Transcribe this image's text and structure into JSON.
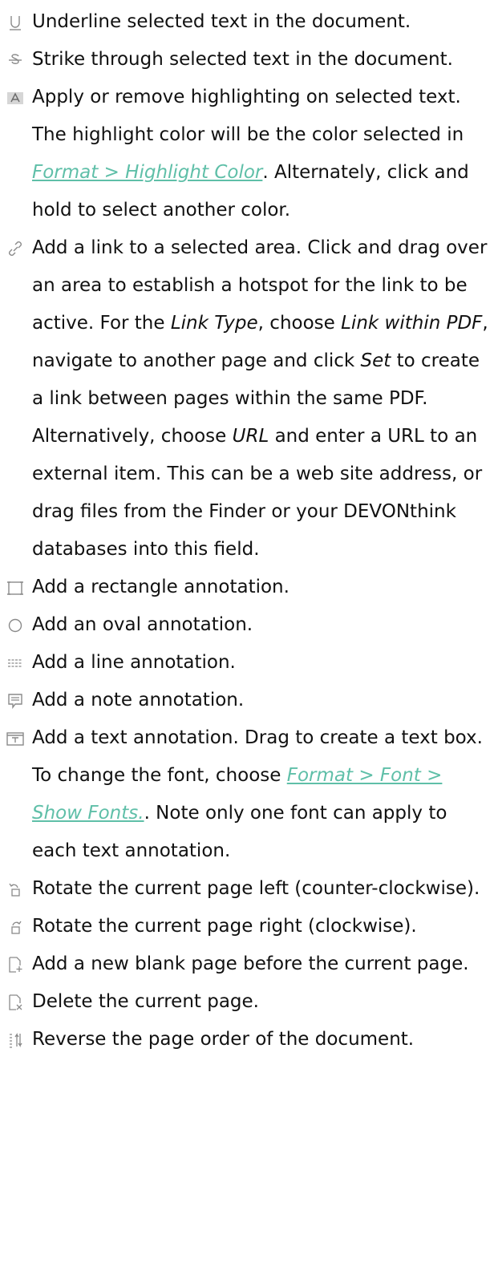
{
  "items": [
    {
      "icon": "underline-icon",
      "text": "Underline selected text in the document."
    },
    {
      "icon": "strikethrough-icon",
      "text": "Strike through selected text in the document."
    },
    {
      "icon": "highlight-icon",
      "pre": "Apply or remove highlighting on selected text. The highlight color will be the color selected in ",
      "link": "Format > Highlight Color",
      "post": ". Alternately, click and hold to select another color."
    },
    {
      "icon": "link-icon",
      "p1": "Add a link to a selected area. Click and drag over an area to establish a hotspot for the link to be active. For the ",
      "e1": "Link Type",
      "p2": ", choose ",
      "e2": "Link within PDF",
      "p3": ", navigate to another page and click ",
      "e3": "Set",
      "p4": " to create a link between pages within the same PDF. Alternatively, choose ",
      "e4": "URL",
      "p5": " and enter a URL to an external item. This can be a web site address, or drag files from the Finder or your DEVONthink databases into this field."
    },
    {
      "icon": "rectangle-icon",
      "text": "Add a rectangle annotation."
    },
    {
      "icon": "oval-icon",
      "text": "Add an oval annotation."
    },
    {
      "icon": "line-icon",
      "text": "Add a line annotation."
    },
    {
      "icon": "note-icon",
      "text": "Add a note annotation."
    },
    {
      "icon": "text-box-icon",
      "pre": "Add a text annotation. Drag to create a text box. To change the font, choose ",
      "link": "Format > Font > Show Fonts.",
      "post": ". Note only one font can apply to each text annotation."
    },
    {
      "icon": "rotate-left-icon",
      "text": "Rotate the current page left (counter-clockwise)."
    },
    {
      "icon": "rotate-right-icon",
      "text": "Rotate the current page right (clockwise)."
    },
    {
      "icon": "add-page-icon",
      "text": "Add a new blank page before the current page."
    },
    {
      "icon": "delete-page-icon",
      "text": "Delete the current page."
    },
    {
      "icon": "reverse-order-icon",
      "text": "Reverse the page order of the document."
    }
  ],
  "colors": {
    "text": "#111111",
    "link": "#5fbfa8",
    "icon": "#8a8a8a"
  }
}
